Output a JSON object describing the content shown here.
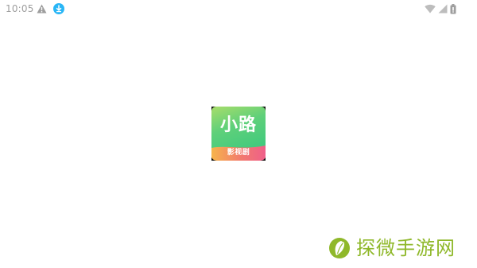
{
  "status_bar": {
    "time": "10:05",
    "left_icons": [
      "warning-icon",
      "download-icon"
    ],
    "right_icons": [
      "wifi-icon",
      "signal-icon",
      "battery-icon"
    ]
  },
  "splash": {
    "logo_title": "小路",
    "logo_subtitle": "影视剧",
    "colors": {
      "green_light": "#a8dd6a",
      "green_dark": "#3ec97e",
      "ribbon_orange": "#f6b44b",
      "ribbon_pink": "#ef5f8a"
    }
  },
  "watermark": {
    "text": "探微手游网",
    "icon": "leaf-logo-icon",
    "color": "#8fb82a"
  }
}
